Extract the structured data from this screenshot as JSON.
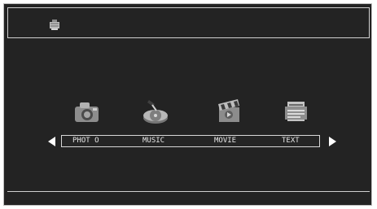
{
  "window": {
    "title": ""
  },
  "menu": {
    "items": [
      {
        "label": "PHOT O",
        "icon": "camera-icon"
      },
      {
        "label": "MUSIC",
        "icon": "disc-player-icon"
      },
      {
        "label": "MOVIE",
        "icon": "clapperboard-icon"
      },
      {
        "label": "TEXT",
        "icon": "document-stack-icon"
      }
    ]
  },
  "navigation": {
    "left": "left-arrow-icon",
    "right": "right-arrow-icon"
  },
  "colors": {
    "background": "#232323",
    "border": "#cfcfcf",
    "text": "#e6e6e6"
  }
}
